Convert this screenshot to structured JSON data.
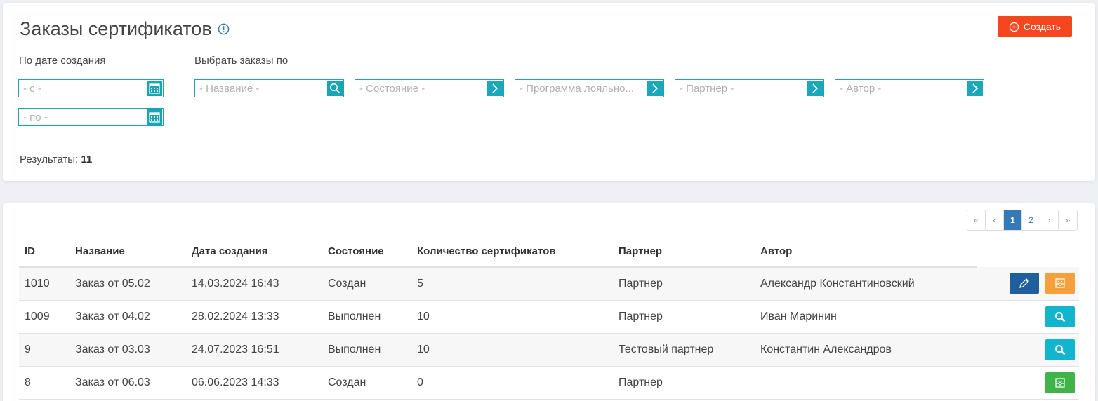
{
  "header": {
    "title": "Заказы сертификатов",
    "create_label": "Создать"
  },
  "filters": {
    "date_label": "По дате создания",
    "select_label": "Выбрать заказы по",
    "date_from_placeholder": "- с -",
    "date_to_placeholder": "- по -",
    "name_placeholder": "- Название -",
    "state_placeholder": "- Состояние -",
    "program_placeholder": "- Программа лояльно...",
    "partner_placeholder": "- Партнер -",
    "author_placeholder": "- Автор -"
  },
  "results": {
    "label": "Результаты:",
    "count": "11"
  },
  "pagination": {
    "first": "«",
    "prev": "‹",
    "pages": [
      "1",
      "2"
    ],
    "current": "1",
    "next": "›",
    "last": "»"
  },
  "table": {
    "columns": [
      "ID",
      "Название",
      "Дата создания",
      "Состояние",
      "Количество сертификатов",
      "Партнер",
      "Автор"
    ],
    "rows": [
      {
        "id": "1010",
        "name": "Заказ от 05.02",
        "created": "14.03.2024 16:43",
        "state": "Создан",
        "count": "5",
        "partner": "Партнер",
        "author": "Александр Константиновский",
        "actions": [
          "edit-icon",
          "archive-icon"
        ]
      },
      {
        "id": "1009",
        "name": "Заказ от 04.02",
        "created": "28.02.2024 13:33",
        "state": "Выполнен",
        "count": "10",
        "partner": "Партнер",
        "author": "Иван Маринин",
        "actions": [
          "search-icon"
        ]
      },
      {
        "id": "9",
        "name": "Заказ от 03.03",
        "created": "24.07.2023 16:51",
        "state": "Выполнен",
        "count": "10",
        "partner": "Тестовый партнер",
        "author": "Константин Александров",
        "actions": [
          "search-icon"
        ]
      },
      {
        "id": "8",
        "name": "Заказ от 06.03",
        "created": "06.06.2023 14:33",
        "state": "Создан",
        "count": "0",
        "partner": "Партнер",
        "author": "",
        "actions": [
          "archive-icon-green"
        ]
      }
    ]
  },
  "colors": {
    "accent": "#17a5b8",
    "create_button": "#f5471d",
    "edit_button": "#1f5f9e",
    "archive_button": "#f5a03a",
    "view_button": "#12b5ce",
    "archive_green_button": "#3fb44a",
    "pager_active": "#337ab7"
  }
}
